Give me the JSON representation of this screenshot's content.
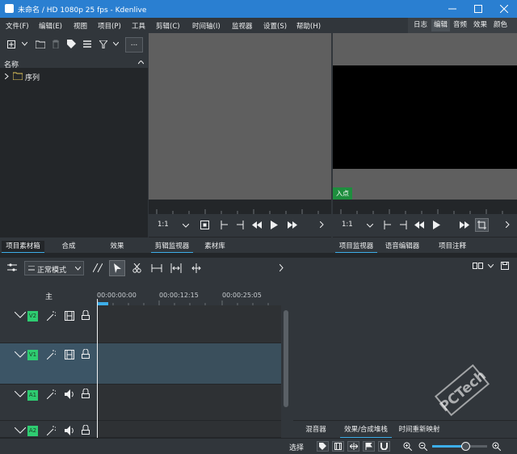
{
  "window": {
    "title": "未命名 / HD 1080p 25 fps - Kdenlive"
  },
  "menu": [
    "文件(F)",
    "编辑(E)",
    "视图",
    "项目(P)",
    "工具",
    "剪辑(C)",
    "时间轴(I)",
    "监视器",
    "设置(S)",
    "帮助(H)"
  ],
  "workspaces": [
    "日志",
    "编辑",
    "音频",
    "效果",
    "颜色"
  ],
  "bin": {
    "header": "名称",
    "folder": "序列",
    "more": "..."
  },
  "left_tabs": [
    "项目素材箱",
    "合成",
    "效果"
  ],
  "clip_monitor": {
    "zoom": "1:1",
    "tabs": [
      "剪辑监视器",
      "素材库"
    ]
  },
  "project_monitor": {
    "zoom": "1:1",
    "in_point": "入点",
    "tabs": [
      "项目监视器",
      "语音编辑器",
      "项目注释"
    ]
  },
  "timeline": {
    "mode": "正常模式",
    "master": "主",
    "timecodes": [
      "00:00:00:00",
      "00:00:12:15",
      "00:00:25:05"
    ],
    "tracks": [
      {
        "label": "V2",
        "type": "video"
      },
      {
        "label": "V1",
        "type": "video"
      },
      {
        "label": "A1",
        "type": "audio"
      },
      {
        "label": "A2",
        "type": "audio"
      }
    ]
  },
  "effects_tabs": [
    "混音器",
    "效果/合成堆栈",
    "时间重新映射"
  ],
  "status": {
    "select": "选择",
    "zoom_value": 0.62
  },
  "watermark": "PCTech"
}
